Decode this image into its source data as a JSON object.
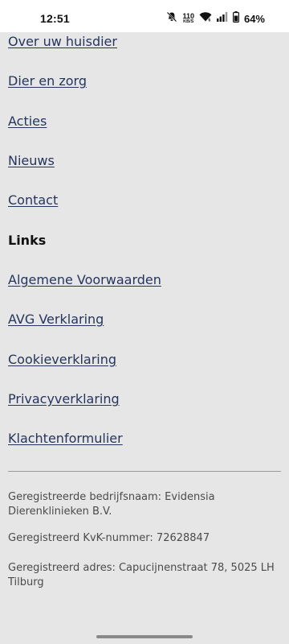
{
  "status_bar": {
    "time": "12:51",
    "net_speed_value": "110",
    "net_speed_unit": "KB/S",
    "battery_percent": "64%",
    "icons": [
      "bell-off-icon",
      "wifi-icon",
      "signal-icon",
      "battery-icon"
    ]
  },
  "nav": {
    "items": [
      {
        "label": "Over uw huisdier"
      },
      {
        "label": "Dier en zorg"
      },
      {
        "label": "Acties"
      },
      {
        "label": "Nieuws"
      },
      {
        "label": "Contact"
      }
    ]
  },
  "links_section": {
    "heading": "Links",
    "items": [
      {
        "label": "Algemene Voorwaarden"
      },
      {
        "label": "AVG Verklaring"
      },
      {
        "label": "Cookieverklaring"
      },
      {
        "label": "Privacyverklaring"
      },
      {
        "label": "Klachtenformulier"
      }
    ]
  },
  "footer": {
    "company_name": "Geregistreerde bedrijfsnaam: Evidensia Dierenklinieken B.V.",
    "kvk": "Geregistreerd KvK-nummer: 72628847",
    "address": "Geregistreerd adres: Capucijnenstraat 78, 5025 LH Tilburg"
  },
  "colors": {
    "background": "#e6e6e6",
    "link": "#25355c",
    "heading": "#111111",
    "footer_text": "#4b4b4b"
  }
}
